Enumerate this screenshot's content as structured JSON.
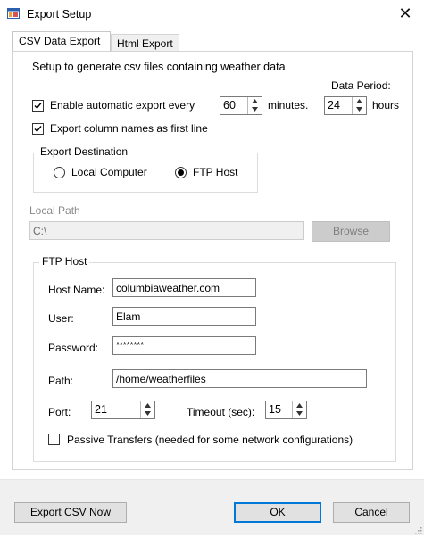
{
  "window": {
    "title": "Export Setup",
    "close_glyph": "✕",
    "icon": "app-window-icon"
  },
  "tabs": [
    {
      "label": "CSV Data Export",
      "active": true
    },
    {
      "label": "Html Export",
      "active": false
    }
  ],
  "csv": {
    "description": "Setup to generate csv files containing weather data",
    "enable_auto_export": {
      "label": "Enable automatic export every",
      "checked": true
    },
    "interval_value": "60",
    "interval_unit": "minutes.",
    "data_period_label": "Data Period:",
    "data_period_value": "24",
    "data_period_unit": "hours",
    "column_names": {
      "label": "Export column names as first line",
      "checked": true
    },
    "destination": {
      "legend": "Export Destination",
      "local_label": "Local Computer",
      "ftp_label": "FTP Host",
      "selected": "FTP Host"
    },
    "local_path": {
      "label": "Local Path",
      "value": "C:\\",
      "browse_label": "Browse"
    },
    "ftp": {
      "legend": "FTP Host",
      "host_label": "Host Name:",
      "host_value": "columbiaweather.com",
      "user_label": "User:",
      "user_value": "Elam",
      "password_label": "Password:",
      "password_value": "********",
      "path_label": "Path:",
      "path_value": "/home/weatherfiles",
      "port_label": "Port:",
      "port_value": "21",
      "timeout_label": "Timeout (sec):",
      "timeout_value": "15",
      "passive": {
        "label": "Passive Transfers (needed for some network configurations)",
        "checked": false
      }
    }
  },
  "footer": {
    "export_now_label": "Export CSV Now",
    "ok_label": "OK",
    "cancel_label": "Cancel"
  },
  "colors": {
    "focus_blue": "#0078d7",
    "footer_bg": "#f0f0f0",
    "disabled_bg": "#f0f0f0"
  }
}
